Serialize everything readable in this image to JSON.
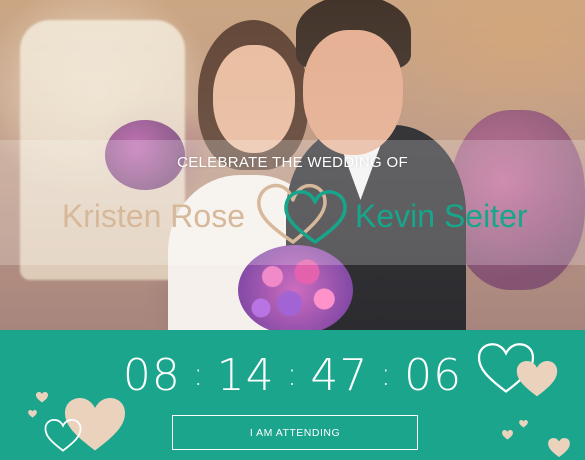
{
  "hero": {
    "subtitle": "CELEBRATE THE WEDDING OF",
    "bride_name": "Kristen Rose",
    "groom_name": "Kevin Seiter"
  },
  "countdown": {
    "hours": "08",
    "minutes": "14",
    "seconds": "47",
    "frames": "06",
    "separator": ":"
  },
  "cta": {
    "label": "I AM ATTENDING"
  },
  "colors": {
    "accent": "#1aa58c",
    "gold": "#d7b89a",
    "white": "#ffffff"
  },
  "icons": [
    "heart-pair-logo-icon",
    "heart-outline-icon",
    "heart-filled-icon"
  ]
}
